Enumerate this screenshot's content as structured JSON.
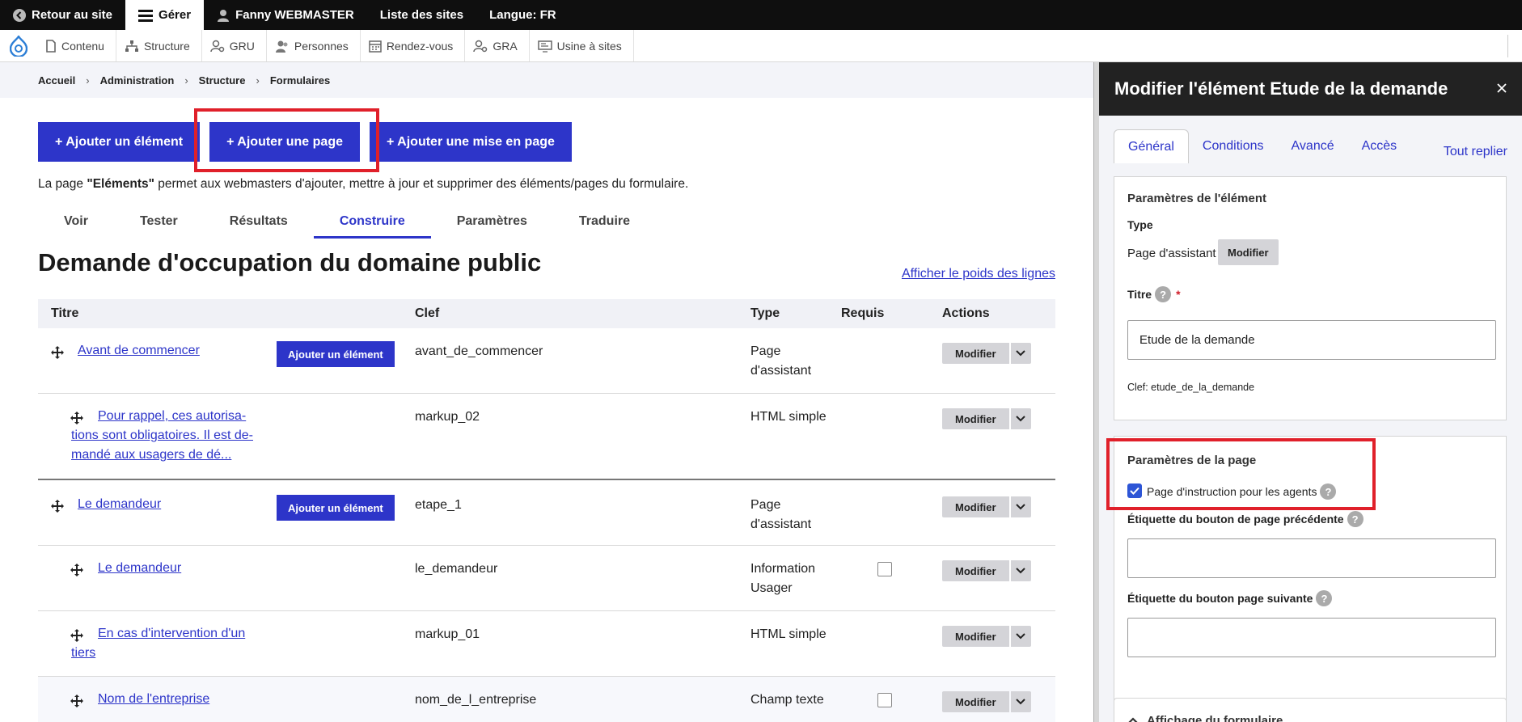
{
  "toolbar": {
    "back": "Retour au site",
    "manage": "Gérer",
    "user": "Fanny WEBMASTER",
    "sites": "Liste des sites",
    "language": "Langue: FR"
  },
  "tray": {
    "items": [
      "Contenu",
      "Structure",
      "GRU",
      "Personnes",
      "Rendez-vous",
      "GRA",
      "Usine à sites"
    ]
  },
  "breadcrumb": [
    "Accueil",
    "Administration",
    "Structure",
    "Formulaires"
  ],
  "actions": {
    "add_element": "+ Ajouter un élément",
    "add_page": "+ Ajouter une page",
    "add_layout": "+ Ajouter une mise en page"
  },
  "intro": {
    "before": "La page ",
    "strong": "\"Eléments\"",
    "after": " permet aux webmasters d'ajouter, mettre à jour et supprimer des éléments/pages du formulaire."
  },
  "tabs": [
    "Voir",
    "Tester",
    "Résultats",
    "Construire",
    "Paramètres",
    "Traduire"
  ],
  "page_title": "Demande d'occupation du domaine public",
  "weights_link": "Afficher le poids des lignes",
  "table": {
    "headers": {
      "title": "Titre",
      "key": "Clef",
      "type": "Type",
      "required": "Requis",
      "actions": "Actions"
    },
    "add_element_label": "Ajouter un élément",
    "modify_label": "Modifier",
    "rows": [
      {
        "title": "Avant de commencer",
        "key": "avant_de_commencer",
        "type_l1": "Page",
        "type_l2": "d'assistant"
      },
      {
        "title_l1": "Pour rappel, ces autorisa-",
        "title_l2": "tions sont obligatoires. Il est de-",
        "title_l3": "mandé aux usagers de dé...",
        "key": "markup_02",
        "type": "HTML simple"
      },
      {
        "title": "Le demandeur",
        "key": "etape_1",
        "type_l1": "Page",
        "type_l2": "d'assistant"
      },
      {
        "title": "Le demandeur",
        "key": "le_demandeur",
        "type_l1": "Information",
        "type_l2": "Usager"
      },
      {
        "title_l1": "En cas d'intervention d'un",
        "title_l2": "tiers",
        "key": "markup_01",
        "type": "HTML simple"
      },
      {
        "title": "Nom de l'entreprise",
        "key": "nom_de_l_entreprise",
        "type": "Champ texte"
      }
    ]
  },
  "sidebar": {
    "title": "Modifier l'élément Etude de la demande",
    "tabs": [
      "Général",
      "Conditions",
      "Avancé",
      "Accès"
    ],
    "collapse_all": "Tout replier",
    "element_settings": {
      "heading": "Paramètres de l'élément",
      "type_label": "Type",
      "type_value": "Page d'assistant",
      "modify": "Modifier",
      "title_label": "Titre",
      "title_value": "Etude de la demande",
      "key_text": "Clef: etude_de_la_demande"
    },
    "page_settings": {
      "heading": "Paramètres de la page",
      "checkbox_label": "Page d'instruction pour les agents",
      "prev_label": "Étiquette du bouton de page précédente",
      "next_label": "Étiquette du bouton page suivante"
    },
    "form_display": "Affichage du formulaire"
  }
}
